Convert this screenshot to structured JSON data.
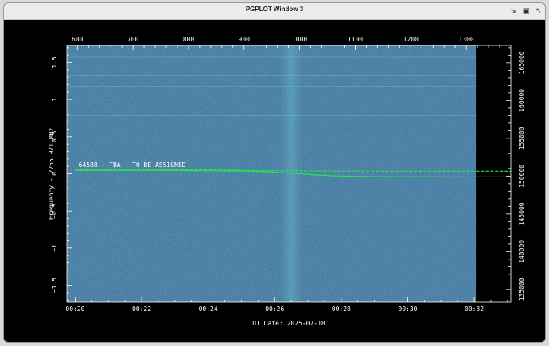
{
  "window": {
    "title": "PGPLOT Window 3",
    "controls": [
      "minimize",
      "maximize",
      "close"
    ]
  },
  "colors": {
    "background": "#000000",
    "waterfall": "#2f6c95",
    "axis": "#ffffff",
    "track": "#22ee44"
  },
  "chart_data": {
    "type": "heatmap",
    "xlabel": "UT Date: 2025-07-18",
    "ylabel": "Frequency - 2255.971 MHz",
    "x_bottom_ticks": [
      "00:20",
      "00:22",
      "00:24",
      "00:26",
      "00:28",
      "00:30",
      "00:32"
    ],
    "x_bottom_minutes": [
      20,
      22,
      24,
      26,
      28,
      30,
      32
    ],
    "xlim_minutes": [
      19.75,
      33.1
    ],
    "x_top_ticks": [
      600,
      700,
      800,
      900,
      1000,
      1100,
      1200,
      1300
    ],
    "xlim_top": [
      581,
      1380
    ],
    "y_left_ticks": [
      -1.5,
      -1,
      -0.5,
      0,
      0.5,
      1,
      1.5
    ],
    "ylim": [
      -1.73,
      1.73
    ],
    "y_right_ticks": [
      135000,
      140000,
      145000,
      150000,
      155000,
      160000,
      165000
    ],
    "ylim_right": [
      133300,
      167300
    ],
    "data_extent_minutes": [
      19.75,
      32.05
    ],
    "annotation": "64588 - TBA - TO BE ASSIGNED",
    "tracks": [
      {
        "style": "solid",
        "minutes": [
          20.0,
          21.0,
          22.0,
          23.0,
          24.0,
          25.0,
          25.5,
          26.0,
          26.5,
          27.0,
          27.5,
          28.0,
          29.0,
          30.0,
          31.0,
          32.0,
          33.0
        ],
        "freq": [
          0.045,
          0.046,
          0.046,
          0.044,
          0.041,
          0.036,
          0.031,
          0.022,
          0.008,
          -0.008,
          -0.022,
          -0.03,
          -0.037,
          -0.04,
          -0.041,
          -0.042,
          -0.042
        ]
      },
      {
        "style": "dashed",
        "minutes": [
          20.0,
          22.0,
          24.0,
          26.0,
          28.0,
          30.0,
          32.0,
          33.1
        ],
        "freq": [
          0.055,
          0.055,
          0.054,
          0.041,
          0.035,
          0.034,
          0.034,
          0.034
        ]
      }
    ],
    "horizontal_lines": [
      1.57,
      1.33,
      1.18,
      0.78
    ],
    "hot_column_minutes": 26.5,
    "grid": false
  }
}
